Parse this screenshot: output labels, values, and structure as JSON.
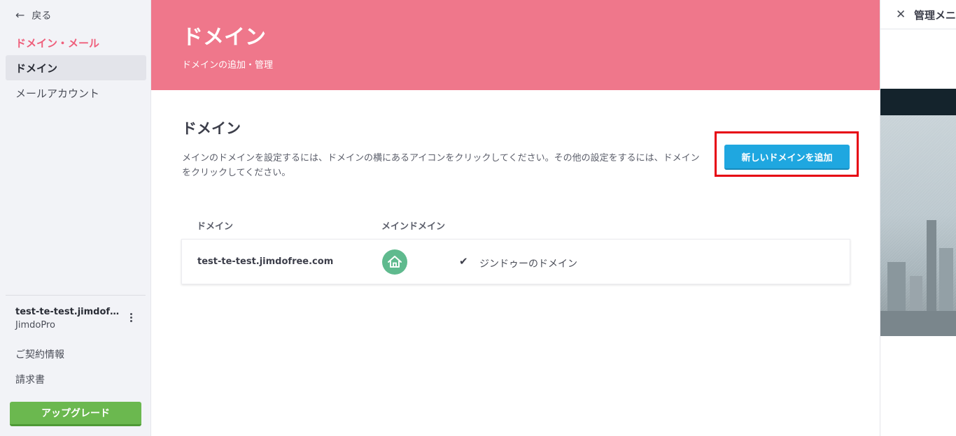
{
  "sidebar": {
    "back_label": "戻る",
    "section_title": "ドメイン・メール",
    "items": [
      {
        "label": "ドメイン",
        "active": true
      },
      {
        "label": "メールアカウント",
        "active": false
      }
    ],
    "site": {
      "name": "test-te-test.jimdofree....",
      "plan": "JimdoPro"
    },
    "links": [
      "ご契約情報",
      "請求書"
    ],
    "upgrade_label": "アップグレード"
  },
  "hero": {
    "title": "ドメイン",
    "subtitle": "ドメインの追加・管理"
  },
  "content": {
    "title": "ドメイン",
    "description": "メインのドメインを設定するには、ドメインの横にあるアイコンをクリックしてください。その他の設定をするには、ドメインをクリックしてください。",
    "add_button": "新しいドメインを追加",
    "table": {
      "headers": [
        "ドメイン",
        "メインドメイン"
      ],
      "rows": [
        {
          "domain": "test-te-test.jimdofree.com",
          "type": "ジンドゥーのドメイン"
        }
      ]
    }
  },
  "right_panel": {
    "title": "管理メニ"
  },
  "colors": {
    "hero": "#ef778b",
    "accent_pink": "#ef5f7b",
    "primary_button": "#1fa7e0",
    "upgrade_button": "#6bb84f",
    "home_icon": "#5fba8e",
    "highlight_box": "#e60012"
  },
  "icons": {
    "back": "arrow-left-icon",
    "menu": "kebab-icon",
    "main_domain": "home-icon",
    "check": "checkmark-icon",
    "close": "close-icon"
  }
}
